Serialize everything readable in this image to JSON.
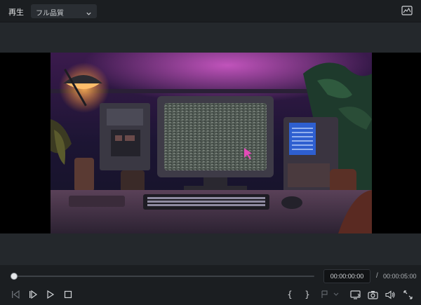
{
  "topbar": {
    "play_label": "再生",
    "quality_value": "フル品質",
    "icons": [
      "chevron-down-icon",
      "video-scope-icon"
    ]
  },
  "video": {
    "description_icon": "video-frame"
  },
  "playback": {
    "current_time": "00:00:00:00",
    "separator": "/",
    "duration": "00:00:05:00",
    "progress": 0.0,
    "mark_in_label": "{",
    "mark_out_label": "}"
  },
  "colors": {
    "background": "#1f2226",
    "bar": "#1b1e21",
    "accent_pink": "#e24bb7"
  }
}
